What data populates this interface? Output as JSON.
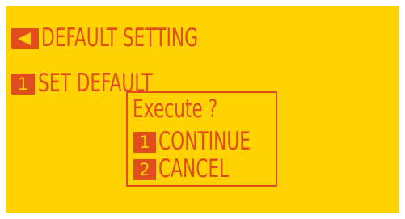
{
  "header": {
    "back_icon": "back-arrow-icon",
    "title": "DEFAULT SETTING"
  },
  "menu": {
    "items": [
      {
        "number": "1",
        "label": "SET DEFAULT"
      }
    ]
  },
  "dialog": {
    "title": "Execute ?",
    "options": [
      {
        "number": "1",
        "label": "CONTINUE"
      },
      {
        "number": "2",
        "label": "CANCEL"
      }
    ]
  },
  "colors": {
    "background": "#ffd200",
    "foreground": "#e14d1c",
    "page": "#ffffff"
  }
}
